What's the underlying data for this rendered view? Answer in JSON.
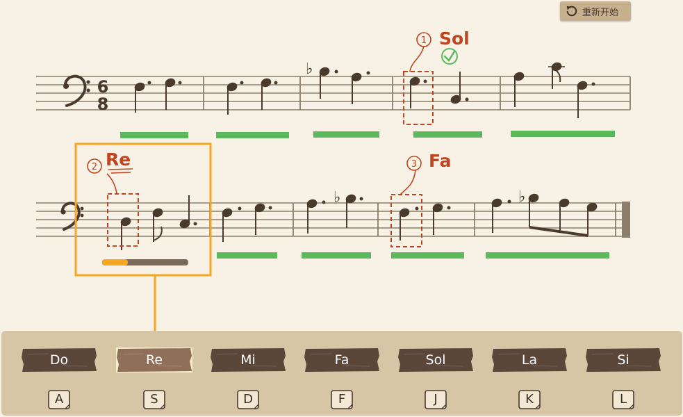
{
  "header": {
    "restart_label": "重新开始"
  },
  "annotations": [
    {
      "num": "1",
      "name": "Sol"
    },
    {
      "num": "2",
      "name": "Re"
    },
    {
      "num": "3",
      "name": "Fa"
    }
  ],
  "time_signature": {
    "top": "6",
    "bottom": "8"
  },
  "progress": {
    "current_note_fraction": 0.3
  },
  "note_keys": [
    {
      "label": "Do",
      "key": "A"
    },
    {
      "label": "Re",
      "key": "S"
    },
    {
      "label": "Mi",
      "key": "D"
    },
    {
      "label": "Fa",
      "key": "F"
    },
    {
      "label": "Sol",
      "key": "J"
    },
    {
      "label": "La",
      "key": "K"
    },
    {
      "label": "Si",
      "key": "L"
    }
  ],
  "active_key": "Re",
  "colors": {
    "accent": "#f5a623",
    "correct_bar": "#5cb85c",
    "annotation": "#c0451f",
    "note_ink": "#4a3a2c",
    "staff": "#8b7e6a",
    "plank": "#5b463a",
    "plank_active": "#8f6f5a"
  }
}
